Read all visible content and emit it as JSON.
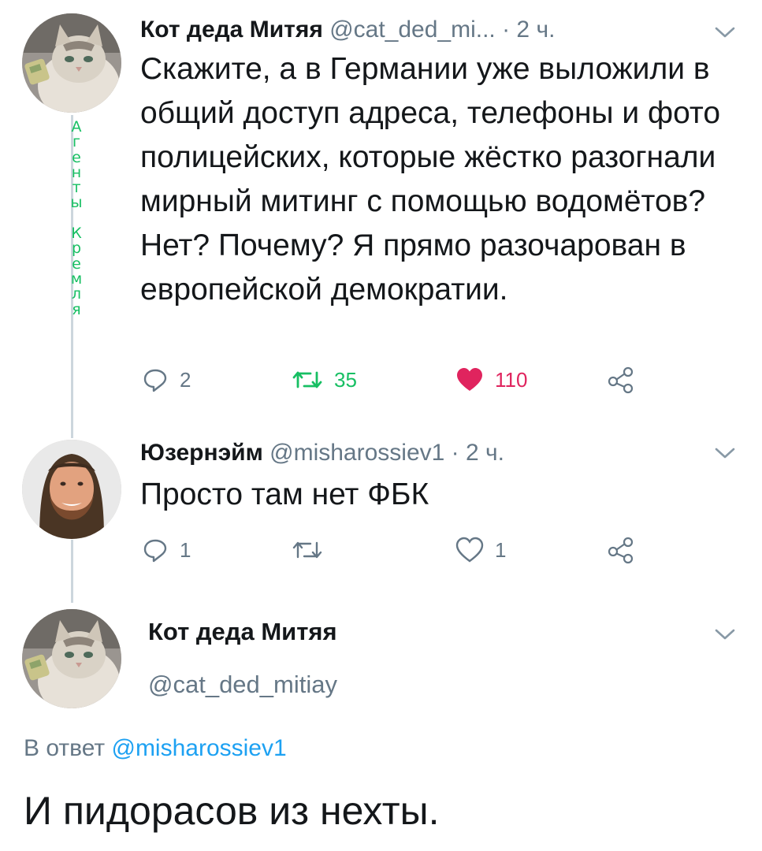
{
  "tweet1": {
    "author_name": "Кот деда Митяя",
    "author_handle": "@cat_ded_mi...",
    "time": "· 2 ч.",
    "text": "Скажите, а в Германии уже выложили в общий доступ адреса, телефоны и фото полицейских, которые жёстко разогнали мирный митинг с помощью водомётов? Нет? Почему? Я прямо разочарован в европейской демократии.",
    "reply_count": "2",
    "retweet_count": "35",
    "like_count": "110"
  },
  "overlay_vertical_text": [
    "А",
    "г",
    "е",
    "н",
    "т",
    "ы",
    " ",
    "К",
    "р",
    "е",
    "м",
    "л",
    "я"
  ],
  "tweet2": {
    "author_name": "Юзернэйм",
    "author_handle": "@misharossiev1",
    "time": "· 2 ч.",
    "text": "Просто там нет ФБК",
    "reply_count": "1",
    "retweet_count": "",
    "like_count": "1"
  },
  "tweet3": {
    "author_name": "Кот деда Митяя",
    "author_handle": "@cat_ded_mitiay",
    "reply_to_prefix": "В ответ",
    "reply_to_handle": "@misharossiev1",
    "text": "И пидорасов из нехты."
  },
  "colors": {
    "text": "#14171a",
    "muted": "#657786",
    "link": "#1da1f2",
    "retweet_green": "#17bf63",
    "like_red": "#e0245e",
    "thread_line": "#ccd6dd"
  },
  "icons": [
    "reply-icon",
    "retweet-icon",
    "like-icon",
    "share-icon",
    "chevron-down-icon"
  ]
}
